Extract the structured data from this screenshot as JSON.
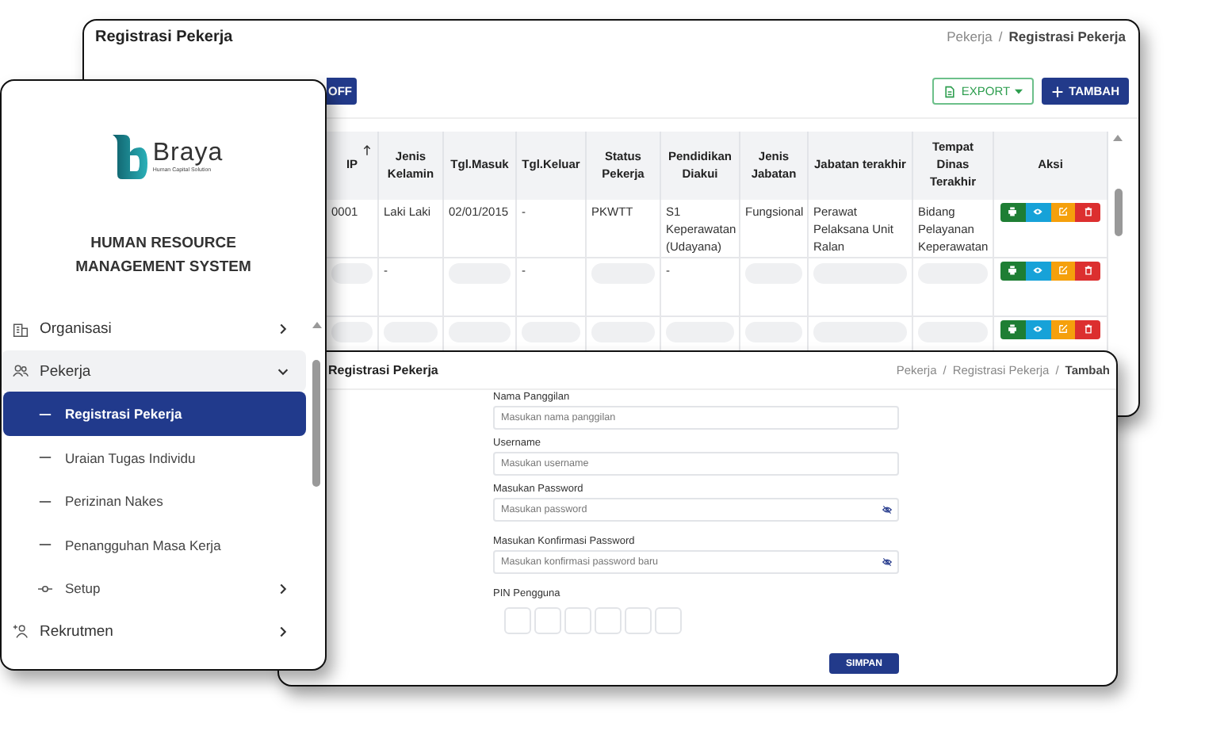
{
  "table_window": {
    "title": "Registrasi Pekerja",
    "breadcrumb": [
      {
        "label": "Pekerja",
        "current": false
      },
      {
        "label": "Registrasi Pekerja",
        "current": true
      }
    ],
    "breadcrumb_separator": "/",
    "toolbar": {
      "partial_button": "OFF",
      "export": "EXPORT",
      "add": "TAMBAH"
    },
    "table": {
      "columns": [
        {
          "label": "IP",
          "sortable": true
        },
        {
          "label": "Jenis Kelamin",
          "sortable": false
        },
        {
          "label": "Tgl.Masuk",
          "sortable": false
        },
        {
          "label": "Tgl.Keluar",
          "sortable": false
        },
        {
          "label": "Status Pekerja",
          "sortable": false
        },
        {
          "label": "Pendidikan Diakui",
          "sortable": false
        },
        {
          "label": "Jenis Jabatan",
          "sortable": false
        },
        {
          "label": "Jabatan terakhir",
          "sortable": false
        },
        {
          "label": "Tempat Dinas Terakhir",
          "sortable": false
        },
        {
          "label": "Aksi",
          "sortable": false
        }
      ],
      "rows": [
        {
          "cells": [
            {
              "kind": "text",
              "text": "0001"
            },
            {
              "kind": "text",
              "text": "Laki Laki"
            },
            {
              "kind": "text",
              "text": "02/01/2015"
            },
            {
              "kind": "text",
              "text": "-"
            },
            {
              "kind": "text",
              "text": "PKWTT"
            },
            {
              "kind": "text",
              "text": "S1 Keperawatan (Udayana)"
            },
            {
              "kind": "text",
              "text": "Fungsional"
            },
            {
              "kind": "text",
              "text": "Perawat Pelaksana Unit Ralan"
            },
            {
              "kind": "text",
              "text": "Bidang Pelayanan Keperawatan"
            }
          ]
        },
        {
          "cells": [
            {
              "kind": "skeleton"
            },
            {
              "kind": "text",
              "text": "-"
            },
            {
              "kind": "skeleton"
            },
            {
              "kind": "text",
              "text": "-"
            },
            {
              "kind": "skeleton"
            },
            {
              "kind": "text",
              "text": "-"
            },
            {
              "kind": "skeleton"
            },
            {
              "kind": "skeleton"
            },
            {
              "kind": "skeleton"
            }
          ]
        },
        {
          "cells": [
            {
              "kind": "skeleton"
            },
            {
              "kind": "skeleton"
            },
            {
              "kind": "skeleton"
            },
            {
              "kind": "skeleton"
            },
            {
              "kind": "skeleton"
            },
            {
              "kind": "skeleton"
            },
            {
              "kind": "skeleton"
            },
            {
              "kind": "skeleton"
            },
            {
              "kind": "skeleton"
            }
          ]
        }
      ]
    }
  },
  "form_window": {
    "title": "Registrasi Pekerja",
    "breadcrumb": [
      {
        "label": "Pekerja",
        "current": false
      },
      {
        "label": "Registrasi Pekerja",
        "current": false
      },
      {
        "label": "Tambah",
        "current": true
      }
    ],
    "breadcrumb_separator": "/",
    "fields": [
      {
        "label": "Nama Panggilan",
        "placeholder": "Masukan nama panggilan",
        "kind": "text"
      },
      {
        "label": "Username",
        "placeholder": "Masukan username",
        "kind": "text"
      },
      {
        "label": "Masukan Password",
        "placeholder": "Masukan password",
        "kind": "password"
      },
      {
        "label": "Masukan Konfirmasi Password",
        "placeholder": "Masukan konfirmasi password baru",
        "kind": "password"
      }
    ],
    "pin_label": "PIN Pengguna",
    "submit": "SIMPAN"
  },
  "sidebar": {
    "brand": "Braya",
    "tagline": "Human Capital Solution",
    "system_name": "HUMAN RESOURCE MANAGEMENT SYSTEM",
    "menu": [
      {
        "label": "Organisasi",
        "kind": "building",
        "expanded": false,
        "selected": false
      },
      {
        "label": "Pekerja",
        "kind": "people",
        "expanded": true,
        "selected": true,
        "children": [
          {
            "label": "Registrasi Pekerja",
            "kind": "page",
            "selected": true
          },
          {
            "label": "Uraian Tugas Individu",
            "kind": "page",
            "selected": false
          },
          {
            "label": "Perizinan Nakes",
            "kind": "page",
            "selected": false
          },
          {
            "label": "Penangguhan Masa Kerja",
            "kind": "page",
            "selected": false
          },
          {
            "label": "Setup",
            "kind": "group",
            "selected": false
          }
        ]
      },
      {
        "label": "Rekrutmen",
        "kind": "recruit",
        "expanded": false,
        "selected": false
      }
    ]
  }
}
